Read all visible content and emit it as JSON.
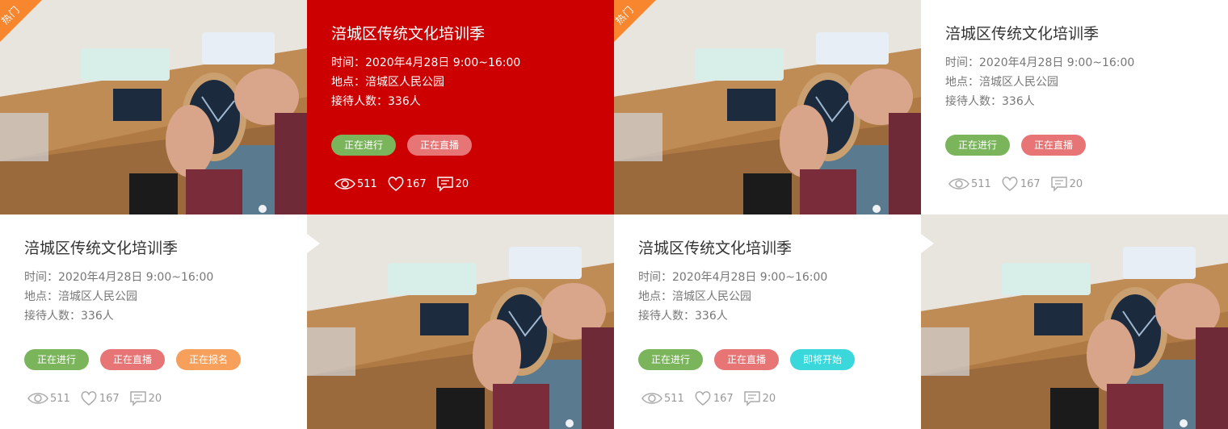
{
  "cards": [
    {
      "title": "涪城区传统文化培训季",
      "time": "时间：2020年4月28日 9:00~16:00",
      "place": "地点：涪城区人民公园",
      "people": "接待人数：336人",
      "tags": [
        "正在进行",
        "正在直播"
      ],
      "views": "511",
      "likes": "167",
      "comments": "20"
    },
    {
      "title": "涪城区传统文化培训季",
      "time": "时间：2020年4月28日 9:00~16:00",
      "place": "地点：涪城区人民公园",
      "people": "接待人数：336人",
      "tags": [
        "正在进行",
        "正在直播"
      ],
      "views": "511",
      "likes": "167",
      "comments": "20"
    },
    {
      "title": "涪城区传统文化培训季",
      "time": "时间：2020年4月28日 9:00~16:00",
      "place": "地点：涪城区人民公园",
      "people": "接待人数：336人",
      "tags": [
        "正在进行",
        "正在直播",
        "正在报名"
      ],
      "views": "511",
      "likes": "167",
      "comments": "20"
    },
    {
      "title": "涪城区传统文化培训季",
      "time": "时间：2020年4月28日 9:00~16:00",
      "place": "地点：涪城区人民公园",
      "people": "接待人数：336人",
      "tags": [
        "正在进行",
        "正在直播",
        "即将开始"
      ],
      "views": "511",
      "likes": "167",
      "comments": "20"
    }
  ],
  "hot_badge": "热门",
  "colors": {
    "red_panel": "#cc0000",
    "badge_orange": "#f7862f",
    "tag_green": "#7ab55c",
    "tag_pink": "#e87575",
    "tag_orange": "#f6a05c",
    "tag_cyan": "#3ad8db"
  }
}
